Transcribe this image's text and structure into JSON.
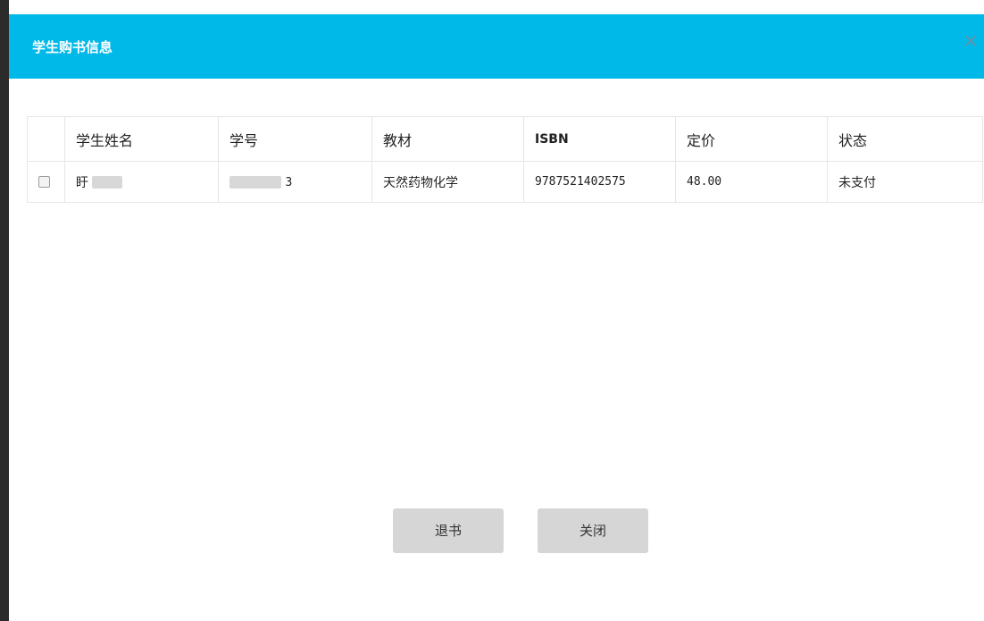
{
  "dialog": {
    "title": "学生购书信息",
    "close_glyph": "×"
  },
  "table": {
    "headers": [
      "学生姓名",
      "学号",
      "教材",
      "ISBN",
      "定价",
      "状态"
    ],
    "rows": [
      {
        "name_visible": "盱",
        "name_tail": "",
        "student_id_tail": "3",
        "textbook": "天然药物化学",
        "isbn": "9787521402575",
        "price": "48.00",
        "status": "未支付"
      }
    ]
  },
  "buttons": {
    "return_label": "退书",
    "close_label": "关闭"
  },
  "colors": {
    "header_bg": "#00b9e8",
    "button_bg": "#d6d6d6"
  }
}
